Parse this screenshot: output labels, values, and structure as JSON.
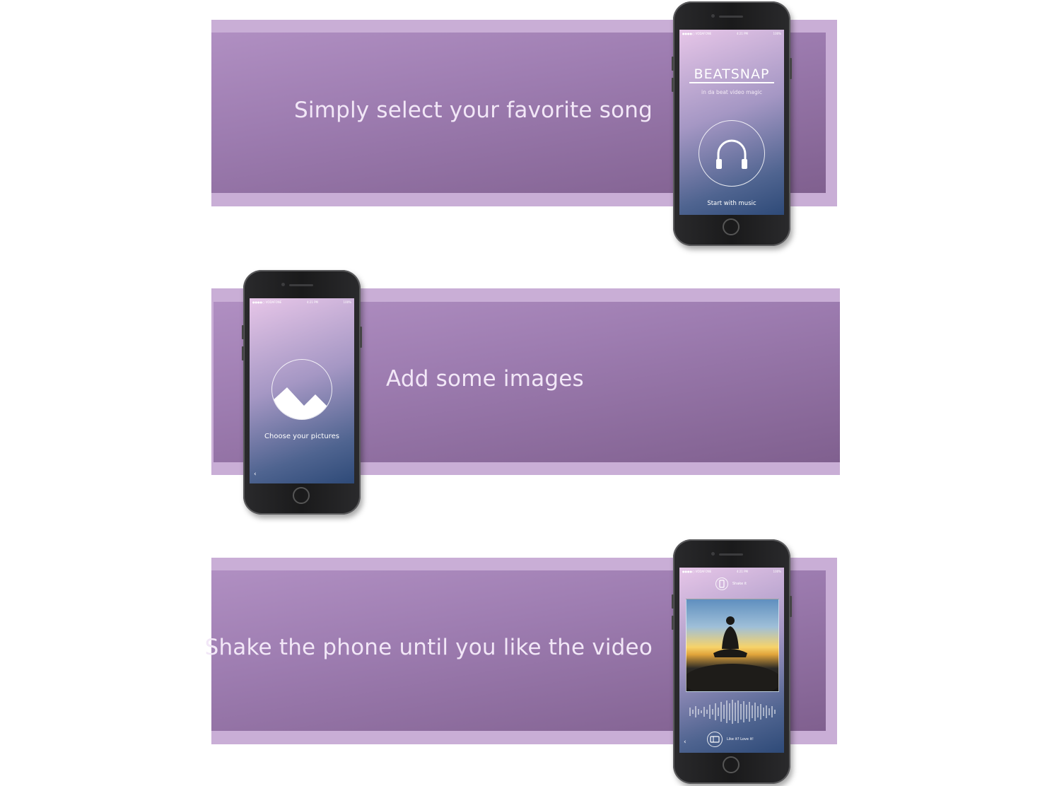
{
  "sections": [
    {
      "text": "Simply select your favorite song"
    },
    {
      "text": "Add some images"
    },
    {
      "text": "Shake the phone until you like the video"
    }
  ],
  "phone1": {
    "status": {
      "carrier": "●●●●○ VODAFONE",
      "time": "4:21 PM",
      "battery": "100%"
    },
    "brand": "BEATSNAP",
    "tagline": "in da beat video magic",
    "action_label": "Start with music",
    "action_icon": "headphones-icon"
  },
  "phone2": {
    "status": {
      "carrier": "●●●●○ VODAFONE",
      "time": "4:21 PM",
      "battery": "100%"
    },
    "action_label": "Choose your pictures",
    "action_icon": "mountain-image-icon",
    "back_glyph": "‹"
  },
  "phone3": {
    "status": {
      "carrier": "●●●●○ VODAFONE",
      "time": "4:21 PM",
      "battery": "100%"
    },
    "shake_label": "Shake it",
    "love_label": "Like it? Love it!",
    "back_glyph": "‹"
  },
  "colors": {
    "band_outer": "#c9aed6",
    "band_inner_top": "#b08fc2",
    "band_inner_bottom": "#80608f",
    "text": "#f2e7f7"
  }
}
